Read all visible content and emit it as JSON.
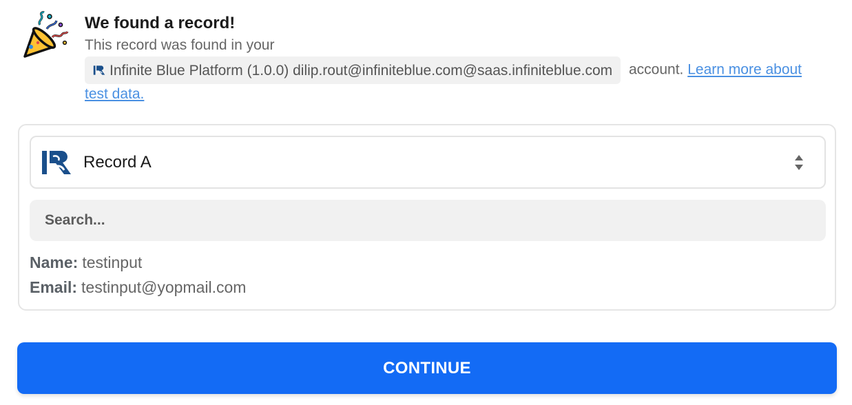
{
  "header": {
    "title": "We found a record!",
    "subtitle": "This record was found in your",
    "account_name": "Infinite Blue Platform (1.0.0) dilip.rout@infiniteblue.com@saas.infiniteblue.com",
    "account_suffix": "account.",
    "learn_link_part1": "Learn more about",
    "learn_link_part2": "test data.",
    "icon": "party-popper-icon"
  },
  "record_select": {
    "selected": "Record A",
    "icon": "infinite-blue-logo"
  },
  "search": {
    "placeholder": "Search...",
    "value": ""
  },
  "fields": [
    {
      "label": "Name:",
      "value": "testinput"
    },
    {
      "label": "Email:",
      "value": "testinput@yopmail.com"
    }
  ],
  "continue_label": "CONTINUE",
  "colors": {
    "primary": "#136bf5",
    "link": "#4a90e2",
    "brand_logo": "#1a4f8b"
  }
}
